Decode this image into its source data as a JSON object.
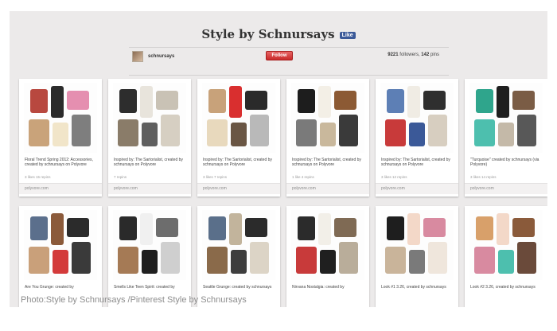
{
  "board": {
    "title": "Style by Schnursays",
    "fb_like": "Like",
    "username": "schnursays",
    "follow_label": "Follow",
    "followers": "9221",
    "followers_label": "followers,",
    "pins": "142",
    "pins_label": "pins"
  },
  "pins": [
    {
      "desc": "Floral Trend Spring 2012: Accessories, created by schnursays on Polyvore",
      "stats": "3 likes  15 repins",
      "source": "polyvore.com",
      "palette": [
        "#b8483f",
        "#2b2b2b",
        "#e58fb0",
        "#c9a37a",
        "#f1e5c9",
        "#7e7e7e"
      ]
    },
    {
      "desc": "Inspired by: The Sartorialist, created by schnursays on Polyvore",
      "stats": "7 repins",
      "source": "polyvore.com",
      "palette": [
        "#2d2d2d",
        "#e8e4dc",
        "#c9c2b5",
        "#8a7c69",
        "#5f5f5f",
        "#d6cfc2"
      ]
    },
    {
      "desc": "Inspired by: The Sartorialist, created by schnursays on Polyvore",
      "stats": "3 likes  7 repins",
      "source": "polyvore.com",
      "palette": [
        "#c8a27a",
        "#d92f2f",
        "#2a2a2a",
        "#e8d9bd",
        "#6a5644",
        "#b9b9b9"
      ]
    },
    {
      "desc": "Inspired by: The Sartorialist, created by schnursays on Polyvore",
      "stats": "1 like  4 repins",
      "source": "polyvore.com",
      "palette": [
        "#1d1d1d",
        "#f3efe6",
        "#8c5a34",
        "#7a7a7a",
        "#c9b89c",
        "#3a3a3a"
      ]
    },
    {
      "desc": "Inspired by: The Sartorialist, created by schnursays on Polyvore",
      "stats": "3 likes  12 repins",
      "source": "polyvore.com",
      "palette": [
        "#5d7fb5",
        "#f0ece4",
        "#2f2f2f",
        "#c83a3a",
        "#3b5998",
        "#d7cec0"
      ]
    },
    {
      "desc": "\"Turquoise\" created by schnursays (via Polyvore)",
      "stats": "3 likes  14 repins",
      "source": "polyvore.com",
      "palette": [
        "#2fa58c",
        "#1f1f1f",
        "#7a5c45",
        "#4dbfae",
        "#c4b9a8",
        "#585858"
      ]
    },
    {
      "desc": "Are You Grunge: created by",
      "stats": "",
      "source": "",
      "palette": [
        "#5b6f8c",
        "#8b5a3a",
        "#2b2b2b",
        "#c9a07a",
        "#d33a3a",
        "#3a3a3a"
      ]
    },
    {
      "desc": "Smells Like Teen Spirit: created by",
      "stats": "",
      "source": "",
      "palette": [
        "#2a2a2a",
        "#f0f0f0",
        "#6d6d6d",
        "#a57a55",
        "#1e1e1e",
        "#cfcfcf"
      ]
    },
    {
      "desc": "Seattle Grunge: created by schnursays",
      "stats": "",
      "source": "",
      "palette": [
        "#5a6f8a",
        "#c2b49c",
        "#2b2b2b",
        "#8a6a4a",
        "#3d3d3d",
        "#dcd4c6"
      ]
    },
    {
      "desc": "Nirvana Nostalgia: created by",
      "stats": "",
      "source": "",
      "palette": [
        "#2b2b2b",
        "#f2efe8",
        "#7f6a54",
        "#c83a3a",
        "#1f1f1f",
        "#b9ad9a"
      ]
    },
    {
      "desc": "Look #1 3.26, created by schnursays",
      "stats": "",
      "source": "",
      "palette": [
        "#1e1e1e",
        "#f3d8c8",
        "#d88aa0",
        "#c9b49a",
        "#7a7a7a",
        "#efe6dc"
      ]
    },
    {
      "desc": "Look #2 3.26, created by schnursays",
      "stats": "",
      "source": "",
      "palette": [
        "#d8a06a",
        "#f3d8c8",
        "#8a5a3a",
        "#d88aa0",
        "#4dbfae",
        "#6a4a3a"
      ]
    }
  ],
  "caption": "Photo:Style by Schnursays /Pinterest Style by Schnursays"
}
